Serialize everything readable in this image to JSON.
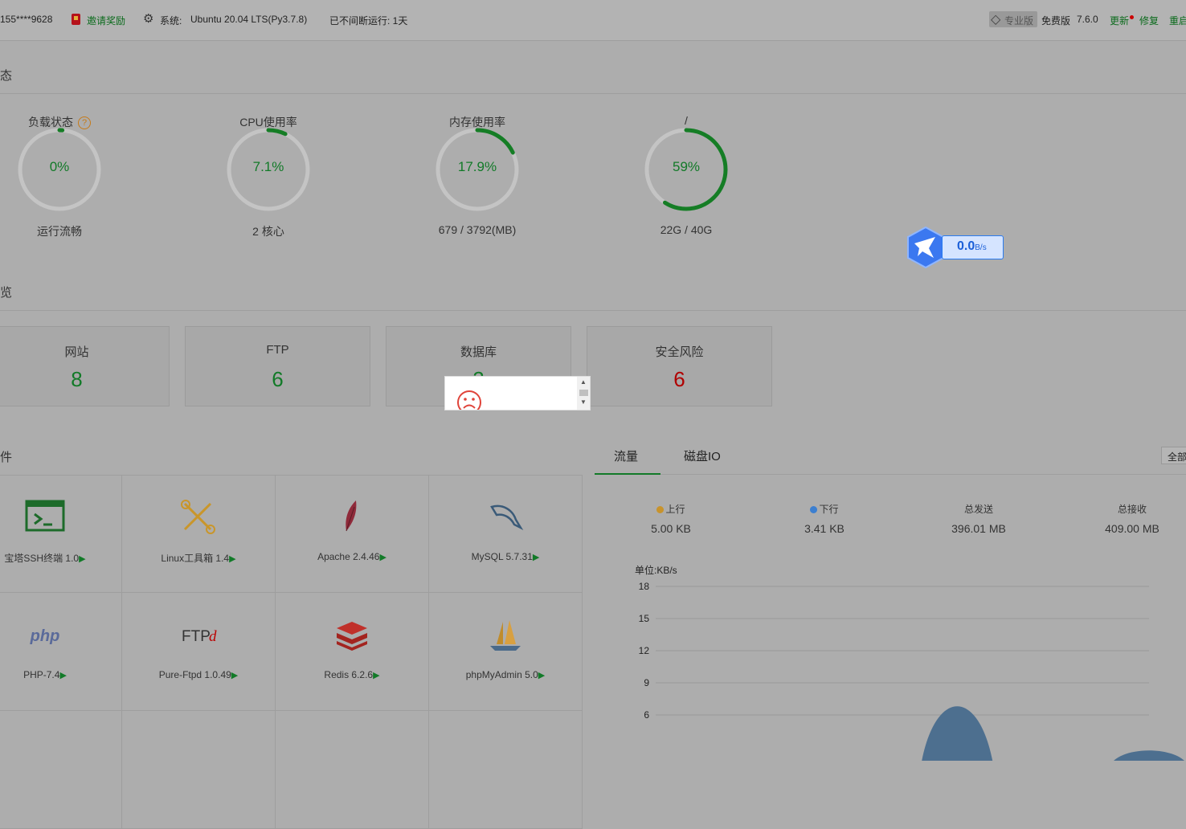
{
  "header": {
    "user": "155****9628",
    "invite_label": "邀请奖励",
    "system_label": "系统:",
    "system_value": "Ubuntu 20.04 LTS(Py3.7.8)",
    "uptime": "已不间断运行: 1天",
    "pro_label": "专业版",
    "free_label": "免费版",
    "version": "7.6.0",
    "update_label": "更新",
    "repair_label": "修复",
    "restart_label": "重启"
  },
  "status_section": {
    "title": "态",
    "gauges": [
      {
        "label": "负载状态",
        "value": "0%",
        "sub": "运行流畅",
        "percent": 0
      },
      {
        "label": "CPU使用率",
        "value": "7.1%",
        "sub": "2 核心",
        "percent": 7.1
      },
      {
        "label": "内存使用率",
        "value": "17.9%",
        "sub": "679 / 3792(MB)",
        "percent": 17.9
      },
      {
        "label": "/",
        "value": "59%",
        "sub": "22G / 40G",
        "percent": 59
      }
    ],
    "gauge_color": "#157d25",
    "track_color": "#c4c4c4"
  },
  "speed_widget": {
    "value": "0.0",
    "unit": "B/s"
  },
  "overview_section": {
    "title": "览",
    "cards": [
      {
        "name": "网站",
        "count": "8",
        "color": "green"
      },
      {
        "name": "FTP",
        "count": "6",
        "color": "green"
      },
      {
        "name": "数据库",
        "count": "2",
        "color": "green"
      },
      {
        "name": "安全风险",
        "count": "6",
        "color": "red"
      }
    ]
  },
  "software_section": {
    "title": "件",
    "items": [
      {
        "name": "宝塔SSH终端 1.0",
        "icon": "terminal-icon"
      },
      {
        "name": "Linux工具箱 1.4",
        "icon": "tools-icon"
      },
      {
        "name": "Apache 2.4.46",
        "icon": "feather-icon"
      },
      {
        "name": "MySQL 5.7.31",
        "icon": "dolphin-icon"
      },
      {
        "name": "PHP-7.4",
        "icon": "php-icon",
        "icon_text": "php"
      },
      {
        "name": "Pure-Ftpd 1.0.49",
        "icon": "ftpd-icon",
        "icon_text": "FTPd"
      },
      {
        "name": "Redis 6.2.6",
        "icon": "redis-icon"
      },
      {
        "name": "phpMyAdmin 5.0",
        "icon": "sailboat-icon"
      }
    ],
    "arrow": "▶"
  },
  "traffic_section": {
    "tabs": [
      "流量",
      "磁盘IO"
    ],
    "all_button": "全部",
    "stats": [
      {
        "label": "上行",
        "value": "5.00 KB",
        "dot": "#c8932c"
      },
      {
        "label": "下行",
        "value": "3.41 KB",
        "dot": "#3c7fd0"
      },
      {
        "label": "总发送",
        "value": "396.01 MB"
      },
      {
        "label": "总接收",
        "value": "409.00 MB"
      }
    ]
  },
  "chart_data": {
    "type": "area",
    "ylabel": "单位:KB/s",
    "y_ticks": [
      18,
      15,
      12,
      9,
      6
    ],
    "ylim": [
      0,
      18
    ],
    "series": [
      {
        "values": [
          0,
          0,
          0,
          0,
          0,
          0,
          0,
          0,
          0,
          0,
          0,
          8.5,
          0,
          0,
          0,
          0,
          0,
          0,
          3
        ]
      }
    ]
  }
}
